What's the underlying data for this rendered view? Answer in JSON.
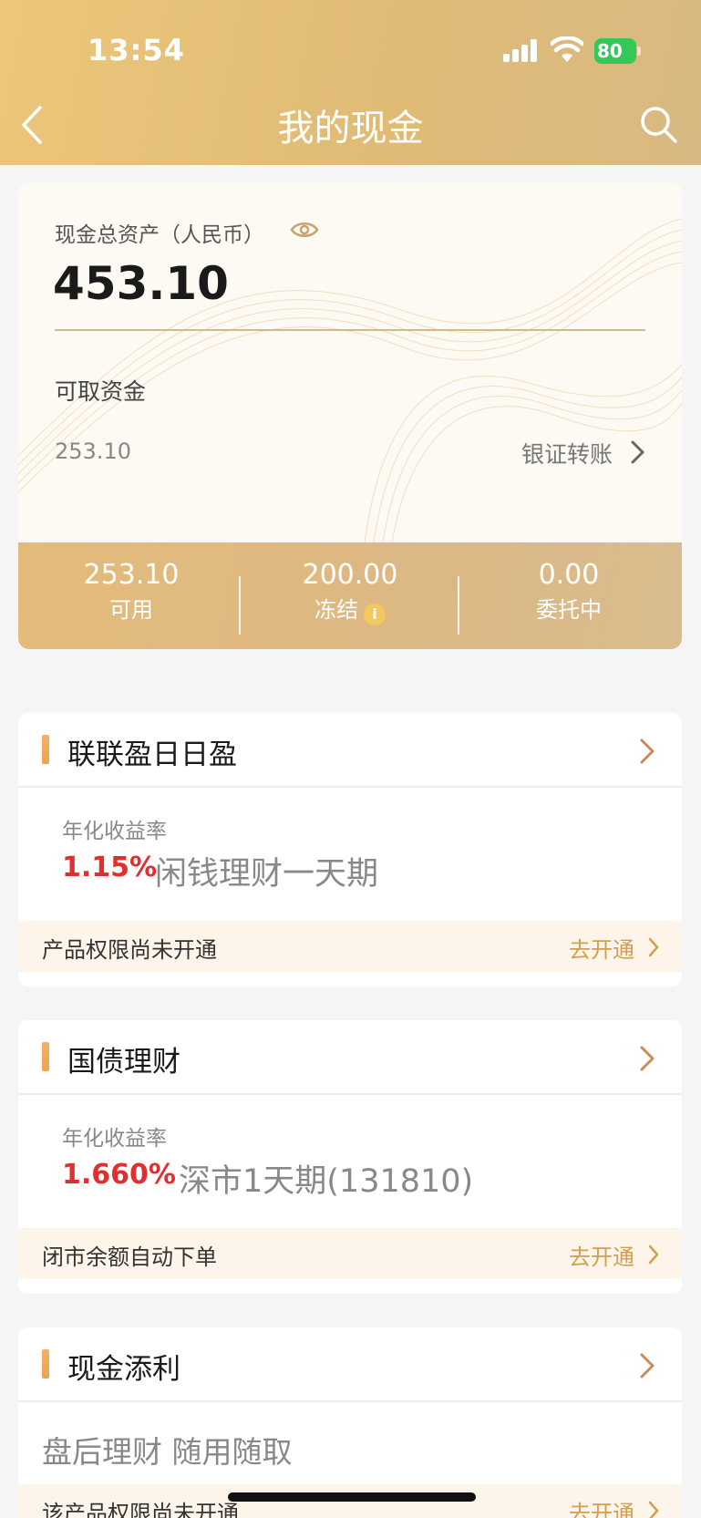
{
  "status_bar": {
    "time": "13:54",
    "battery": "80"
  },
  "header": {
    "title": "我的现金"
  },
  "assets": {
    "total_label": "现金总资产（人民币）",
    "total_value": "453.10",
    "withdrawable_label": "可取资金",
    "withdrawable_value": "253.10",
    "transfer_link": "银证转账",
    "stats": [
      {
        "value": "253.10",
        "label": "可用"
      },
      {
        "value": "200.00",
        "label": "冻结"
      },
      {
        "value": "0.00",
        "label": "委托中"
      }
    ]
  },
  "products": [
    {
      "title": "联联盈日日盈",
      "rate_label": "年化收益率",
      "rate": "1.15%",
      "name": "闲钱理财一天期",
      "notice": "产品权限尚未开通",
      "action": "去开通"
    },
    {
      "title": "国债理财",
      "rate_label": "年化收益率",
      "rate": "1.660%",
      "name": "深市1天期(131810)",
      "notice": "闭市余额自动下单",
      "action": "去开通"
    },
    {
      "title": "现金添利",
      "name": "盘后理财 随用随取",
      "notice": "该产品权限尚未开通",
      "action": "去开通"
    }
  ],
  "colors": {
    "header_gold": "#e3bd78",
    "accent_gold": "#d59d4e",
    "rate_red": "#e02f2f",
    "bar_orange": "#f0a250"
  }
}
